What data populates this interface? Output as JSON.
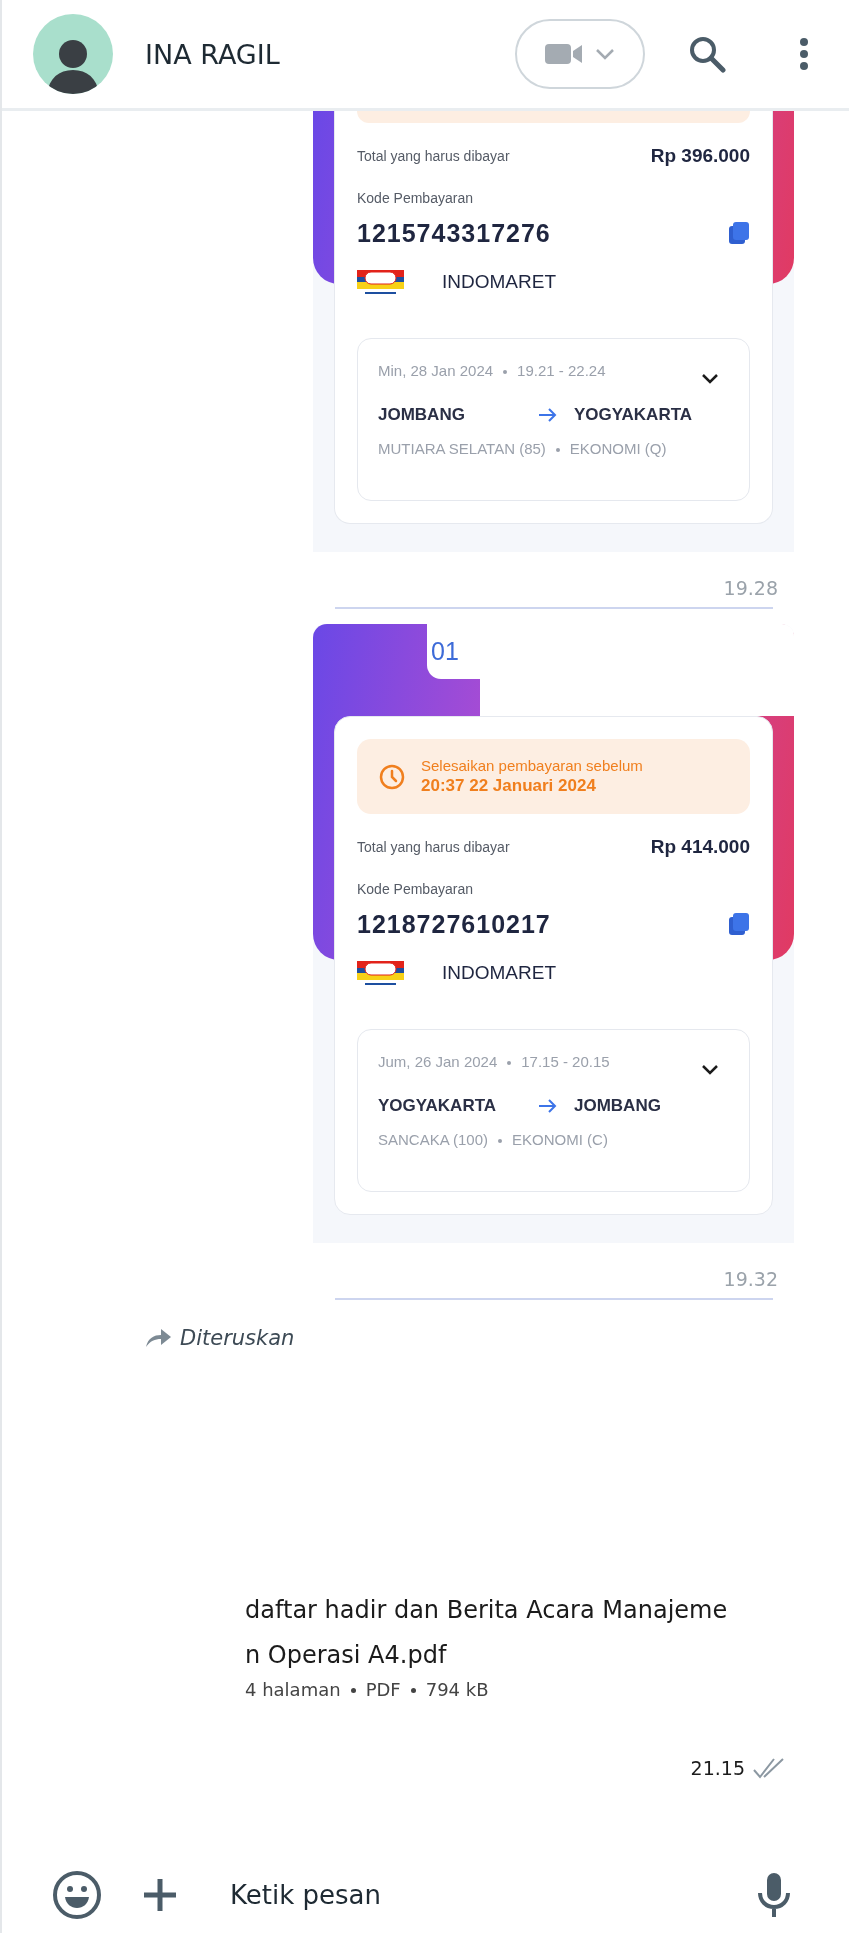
{
  "header": {
    "contact_name": "INA RAGIL"
  },
  "tickets": [
    {
      "total_label": "Total yang harus dibayar",
      "total": "Rp 396.000",
      "code_label": "Kode Pembayaran",
      "code": "1215743317276",
      "merchant": "INDOMARET",
      "trip": {
        "date": "Min, 28 Jan 2024",
        "time": "19.21 - 22.24",
        "from": "JOMBANG",
        "to": "YOGYAKARTA",
        "train": "MUTIARA SELATAN (85)",
        "class": "EKONOMI (Q)"
      },
      "sent_time": "19.28"
    },
    {
      "tab": "01",
      "deadline_label": "Selesaikan pembayaran sebelum",
      "deadline": "20:37 22 Januari 2024",
      "total_label": "Total yang harus dibayar",
      "total": "Rp 414.000",
      "code_label": "Kode Pembayaran",
      "code": "1218727610217",
      "merchant": "INDOMARET",
      "trip": {
        "date": "Jum, 26 Jan 2024",
        "time": "17.15 - 20.15",
        "from": "YOGYAKARTA",
        "to": "JOMBANG",
        "train": "SANCAKA (100)",
        "class": "EKONOMI (C)"
      },
      "sent_time": "19.32"
    }
  ],
  "document": {
    "forwarded_label": "Diteruskan",
    "filename": "daftar hadir dan Berita Acara Manajemen Operasi A4.pdf",
    "meta": [
      "4 halaman",
      "PDF",
      "794 kB"
    ],
    "sent_time": "21.15",
    "read": false
  },
  "composer": {
    "placeholder": "Ketik pesan"
  }
}
